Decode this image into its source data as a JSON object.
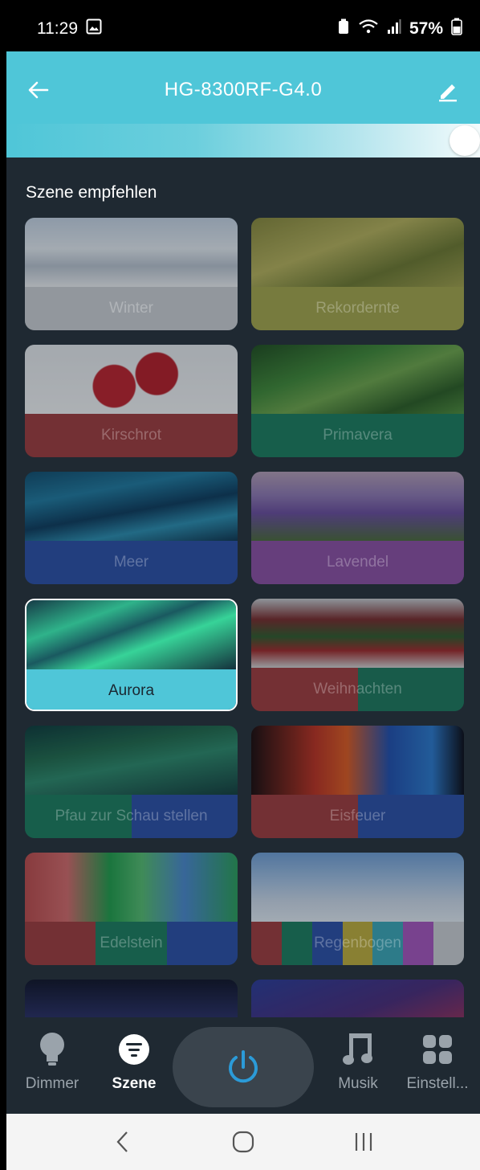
{
  "status_bar": {
    "time": "11:29",
    "battery": "57%"
  },
  "header": {
    "title": "HG-8300RF-G4.0"
  },
  "brightness": {
    "level": 1.0
  },
  "section": {
    "title": "Szene empfehlen"
  },
  "scenes": [
    {
      "label": "Winter",
      "band": [
        "#cfd2d6"
      ],
      "photo": "linear-gradient(180deg,#c8d6e6 0%,#e8eef4 45%,#bcc6d2 70%,#f2f4f6 100%)"
    },
    {
      "label": "Rekordernte",
      "band": [
        "#a7a84a"
      ],
      "photo": "linear-gradient(160deg,#8a8a3a 0%,#b9b45a 40%,#6f7a2e 70%,#a3a24a 100%)"
    },
    {
      "label": "Kirschrot",
      "band": [
        "#a13a3c"
      ],
      "photo": "radial-gradient(circle at 42% 60%,#c0202a 0 16%,transparent 17%),radial-gradient(circle at 62% 42%,#b81b25 0 15%,transparent 16%),linear-gradient(180deg,#e9ecef,#f6f7f8)"
    },
    {
      "label": "Primavera",
      "band": [
        "#1a7e5e"
      ],
      "photo": "linear-gradient(160deg,#1e4d1c 0%,#3f8a35 35%,#6fa84a 55%,#2b5e22 80%,#4f8f3a 100%)"
    },
    {
      "label": "Meer",
      "band": [
        "#2a4fa8"
      ],
      "photo": "linear-gradient(170deg,#0f4c6e 0%,#1e7aa0 30%,#0b3a5c 55%,#2a8fb2 75%,#0c3550 100%)"
    },
    {
      "label": "Lavendel",
      "band": [
        "#8e4ea6"
      ],
      "photo": "linear-gradient(180deg,#b7a0b8 0%,#8f77b4 35%,#6b4c9e 60%,#4c6a3a 100%)"
    },
    {
      "label": "Aurora",
      "band": [
        "#4fc6d8"
      ],
      "photo": "linear-gradient(160deg,#163b47 0%,#2fb38a 28%,#1a5960 45%,#37d398 62%,#14313c 100%)"
    },
    {
      "label": "Weihnachten",
      "band": [
        "#a33a3b",
        "#1b7a5c"
      ],
      "photo": "linear-gradient(180deg,#c9ccd0 0%,#7a2a2a 30%,#2f5b2a 55%,#a22828 75%,#d6d6d6 100%)"
    },
    {
      "label": "Pfau zur Schau stellen",
      "band": [
        "#1a7e5e",
        "#2a4fa8"
      ],
      "photo": "linear-gradient(170deg,#0b3a3a 0%,#1f6b4c 35%,#2b8a6a 55%,#123d3c 100%)"
    },
    {
      "label": "Eisfeuer",
      "band": [
        "#a13a3c",
        "#2a4fa8"
      ],
      "photo": "linear-gradient(90deg,#1a0a0a 0%,#c0301e 30%,#e25a1e 45%,#1f4fb0 65%,#2a7ad0 85%,#0a0a14 100%)"
    },
    {
      "label": "Edelstein",
      "band": [
        "#a13a3c",
        "#1a7e5e",
        "#2a4fa8"
      ],
      "photo": "linear-gradient(90deg,#c04a4a 0%,#d86a6a 20%,#1fa04a 40%,#55c070 55%,#4a8ad0 75%,#2aa05a 100%)"
    },
    {
      "label": "Regenbogen",
      "band": [
        "#a13a3c",
        "#1a7e5e",
        "#2a4fa8",
        "#c2b03a",
        "#3aa8b8",
        "#a855c0",
        "#cfd2d6"
      ],
      "photo": "linear-gradient(180deg,#6fa0d8 0%,#a6c4e6 40%,#cfdcec 70%,#e6eef6 100%)"
    },
    {
      "label": "",
      "band": [
        "#1f2932"
      ],
      "photo": "linear-gradient(180deg,#0e1226 0%,#2a2f6a 60%,#6a3a7a 100%)"
    },
    {
      "label": "",
      "band": [
        "#1f2932"
      ],
      "photo": "linear-gradient(160deg,#2a3a9a 0%,#4a2a7a 50%,#c0304a 100%)"
    }
  ],
  "selected_scene": "Aurora",
  "bottom_nav": {
    "items": [
      {
        "label": "Dimmer",
        "icon": "bulb-icon"
      },
      {
        "label": "Szene",
        "icon": "scene-icon"
      },
      {
        "label": "Musik",
        "icon": "music-icon"
      },
      {
        "label": "Einstell...",
        "icon": "settings-grid-icon"
      }
    ],
    "active": "Szene"
  },
  "colors": {
    "accent": "#4fc6d8",
    "background": "#1f2932",
    "power": "#2b9bd8"
  }
}
